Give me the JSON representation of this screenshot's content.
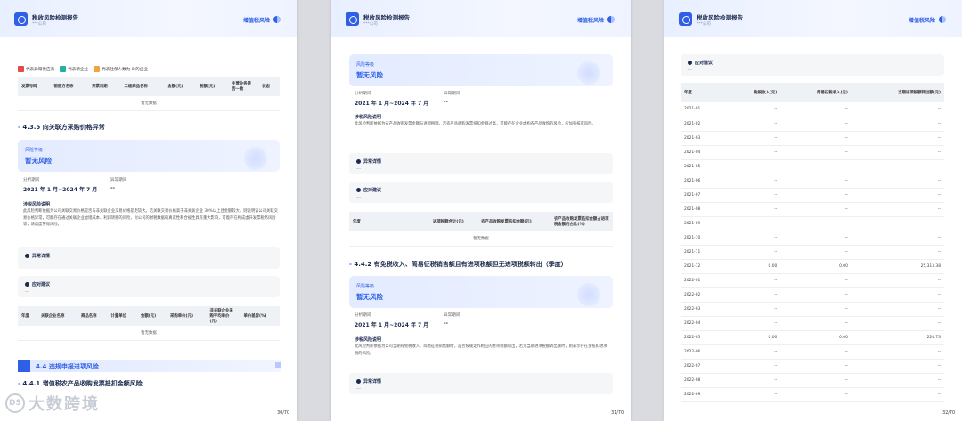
{
  "header": {
    "title": "税收风险检测报告",
    "subtitle": "***公司",
    "tag": "增值税风险"
  },
  "page1": {
    "legend": [
      "代表异常供应商",
      "代表新企业",
      "代表社保人数为 0 的企业"
    ],
    "legend_colors": [
      "#e54b4b",
      "#27b0a0",
      "#f0a640"
    ],
    "table1": {
      "headers": [
        "发票号码",
        "销售方名称",
        "开票日期",
        "二级商品名称",
        "金额(元)",
        "税额(元)",
        "主营业务是否一致",
        "状态"
      ],
      "empty": "暂无数据"
    },
    "section_435": "4.3.5 向关联方采购价格异常",
    "risk": {
      "label": "风险等级",
      "value": "暂无风险",
      "period_label": "分析期间",
      "period": "2021 年 1 月~2024 年 7 月",
      "anomaly_label": "异常期间",
      "anomaly": "--",
      "desc_title": "涉税风险说明",
      "desc": "此风险判断依据为公司关联交易价格是否与非关联企业交易价格差距较大。若关联交易价格高于非关联企业 30%以上且金额较大，则说明该公司关联交易价格异常，可能存在通过关联企业虚增成本、利润转移的风险，对公司的财税数据的真实性和合规性具有重大影响，可能存在构成虚开发票税务风险等，请高度警惕风险。"
    },
    "abnormal_detail": {
      "title": "异常详情",
      "body": "---"
    },
    "suggest": {
      "title": "应对建议",
      "body": "---"
    },
    "table2": {
      "headers": [
        "年度",
        "关联企业名称",
        "商品名称",
        "计量单位",
        "金额(元)",
        "采购单价(元)",
        "非关联企业采购平均单价(元)",
        "单价差异(%)"
      ],
      "empty": "暂无数据"
    },
    "h2_44": "4.4 违规申报进项风险",
    "section_441": "4.4.1 增值税农产品收购发票抵扣金额风险",
    "watermark": "大数跨境",
    "watermark_icon": "DS",
    "page_num": "30/70"
  },
  "page2": {
    "risk1": {
      "label": "风险等级",
      "value": "暂无风险",
      "period_label": "分析期间",
      "period": "2021 年 1 月~2024 年 7 月",
      "anomaly_label": "异常期间",
      "anomaly": "--",
      "desc_title": "涉税风险说明",
      "desc": "此风险判断依据为农产品收购发票金额与进项税额，若农产品收购发票抵扣金额过高，可能存在企业虚构农产品收购的风险，应加强核实风险。"
    },
    "abnormal_detail": {
      "title": "异常详情",
      "body": "---"
    },
    "suggest": {
      "title": "应对建议",
      "body": "---"
    },
    "table": {
      "headers": [
        "年度",
        "进项税额合计(元)",
        "农产品收购发票抵扣金额(元)",
        "农产品收购发票抵扣金额占进项税金额的占比(%)"
      ],
      "empty": "暂无数据"
    },
    "section_442": "4.4.2 有免税收入、简易征税销售额且有进项税额但无进项税额转出（季度）",
    "risk2": {
      "label": "风险等级",
      "value": "暂无风险",
      "period_label": "分析期间",
      "period": "2021 年 1 月~2024 年 7 月",
      "anomaly_label": "异常期间",
      "anomaly": "--",
      "desc_title": "涉税风险说明",
      "desc": "此风险判断依据为公司当期有免税收入、简易征税销售额时，是否按规定作相应的进项税额转出，若无当期进项税额转出额时，则表示存在多抵扣进项税的风险。"
    },
    "abnormal_detail2": {
      "title": "异常详情",
      "body": "---"
    },
    "page_num": "31/70"
  },
  "page3": {
    "suggest": {
      "title": "应对建议",
      "body": "---"
    },
    "table": {
      "headers": [
        "年度",
        "免税收入(元)",
        "简易征税收入(元)",
        "当期进项税额转出额(元)"
      ],
      "rows": [
        [
          "2021-01",
          "--",
          "--",
          "--"
        ],
        [
          "2021-02",
          "--",
          "--",
          "--"
        ],
        [
          "2021-03",
          "--",
          "--",
          "--"
        ],
        [
          "2021-04",
          "--",
          "--",
          "--"
        ],
        [
          "2021-05",
          "--",
          "--",
          "--"
        ],
        [
          "2021-06",
          "--",
          "--",
          "--"
        ],
        [
          "2021-07",
          "--",
          "--",
          "--"
        ],
        [
          "2021-08",
          "--",
          "--",
          "--"
        ],
        [
          "2021-09",
          "--",
          "--",
          "--"
        ],
        [
          "2021-10",
          "--",
          "--",
          "--"
        ],
        [
          "2021-11",
          "--",
          "--",
          "--"
        ],
        [
          "2021-12",
          "0.00",
          "0.00",
          "25,313.38"
        ],
        [
          "2022-01",
          "--",
          "--",
          "--"
        ],
        [
          "2022-02",
          "--",
          "--",
          "--"
        ],
        [
          "2022-03",
          "--",
          "--",
          "--"
        ],
        [
          "2022-04",
          "--",
          "--",
          "--"
        ],
        [
          "2022-05",
          "0.00",
          "0.00",
          "224.73"
        ],
        [
          "2022-06",
          "--",
          "--",
          "--"
        ],
        [
          "2022-07",
          "--",
          "--",
          "--"
        ],
        [
          "2022-08",
          "--",
          "--",
          "--"
        ],
        [
          "2022-09",
          "--",
          "--",
          "--"
        ]
      ]
    },
    "page_num": "32/70"
  }
}
